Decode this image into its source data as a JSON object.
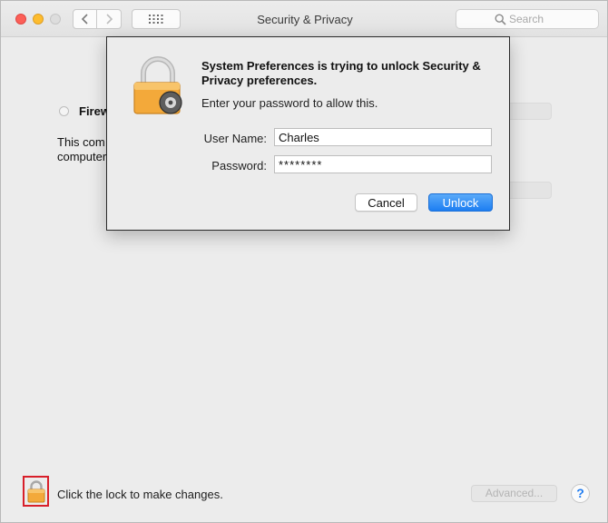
{
  "window": {
    "title": "Security & Privacy",
    "search_placeholder": "Search"
  },
  "background": {
    "firewall_label": "Firew",
    "firewall_desc": "This com computer",
    "bottom_text": "Click the lock to make changes.",
    "advanced_label": "Advanced...",
    "help_label": "?"
  },
  "dialog": {
    "heading": "System Preferences is trying to unlock Security & Privacy preferences.",
    "subtext": "Enter your password to allow this.",
    "username_label": "User Name:",
    "username_value": "Charles",
    "password_label": "Password:",
    "password_value": "********",
    "cancel_label": "Cancel",
    "unlock_label": "Unlock"
  },
  "colors": {
    "accent": "#1d7ef2",
    "lock_gold": "#f3a93a",
    "highlight_border": "#d81f2a"
  },
  "icons": [
    "back-chevron-icon",
    "forward-chevron-icon",
    "grid-icon",
    "search-icon",
    "lock-icon"
  ]
}
